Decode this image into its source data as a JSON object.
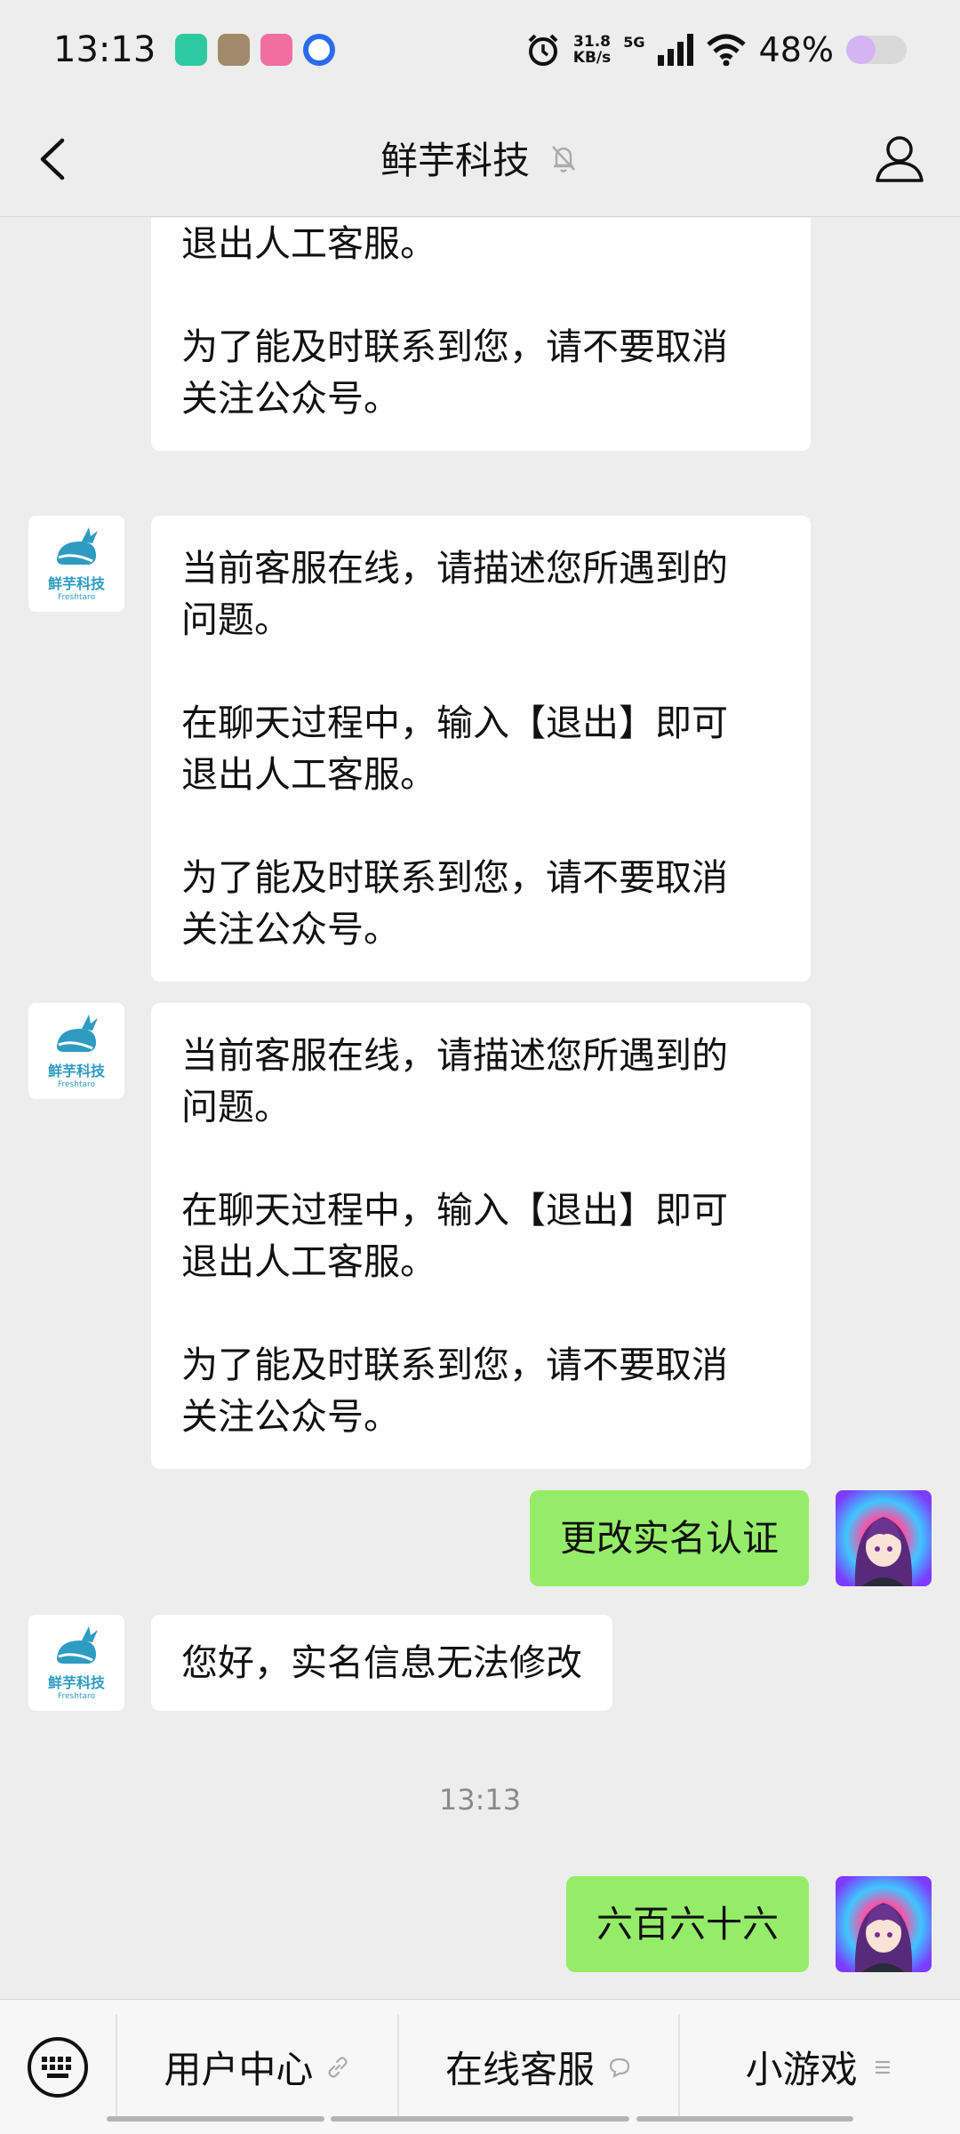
{
  "status_bar": {
    "time": "13:13",
    "speed_value": "31.8",
    "speed_unit": "KB/s",
    "network": "5G",
    "battery_text": "48%",
    "battery_level": 0.48
  },
  "header": {
    "title": "鲜芋科技"
  },
  "bot_avatar": {
    "name_cn": "鲜芋科技",
    "name_en": "Freshtaro"
  },
  "messages": [
    {
      "from": "bot",
      "text": "在聊天过程中，输入【退出】即可\n退出人工客服。\n\n为了能及时联系到您，请不要取消\n关注公众号。"
    },
    {
      "from": "bot",
      "text": "当前客服在线，请描述您所遇到的\n问题。\n\n在聊天过程中，输入【退出】即可\n退出人工客服。\n\n为了能及时联系到您，请不要取消\n关注公众号。"
    },
    {
      "from": "bot",
      "text": "当前客服在线，请描述您所遇到的\n问题。\n\n在聊天过程中，输入【退出】即可\n退出人工客服。\n\n为了能及时联系到您，请不要取消\n关注公众号。"
    },
    {
      "from": "user",
      "text": "更改实名认证"
    },
    {
      "from": "bot",
      "text": "您好，实名信息无法修改"
    },
    {
      "from": "user",
      "text": "六百六十六"
    }
  ],
  "timestamp": "13:13",
  "bottom_menu": [
    {
      "label": "用户中心",
      "icon": "link-icon"
    },
    {
      "label": "在线客服",
      "icon": "chat-bubble-icon"
    },
    {
      "label": "小游戏",
      "icon": "menu-lines-icon"
    }
  ],
  "colors": {
    "background": "#ededed",
    "bubble_out": "#95ec69",
    "bubble_in": "#ffffff",
    "brand": "#2e9bc2"
  }
}
